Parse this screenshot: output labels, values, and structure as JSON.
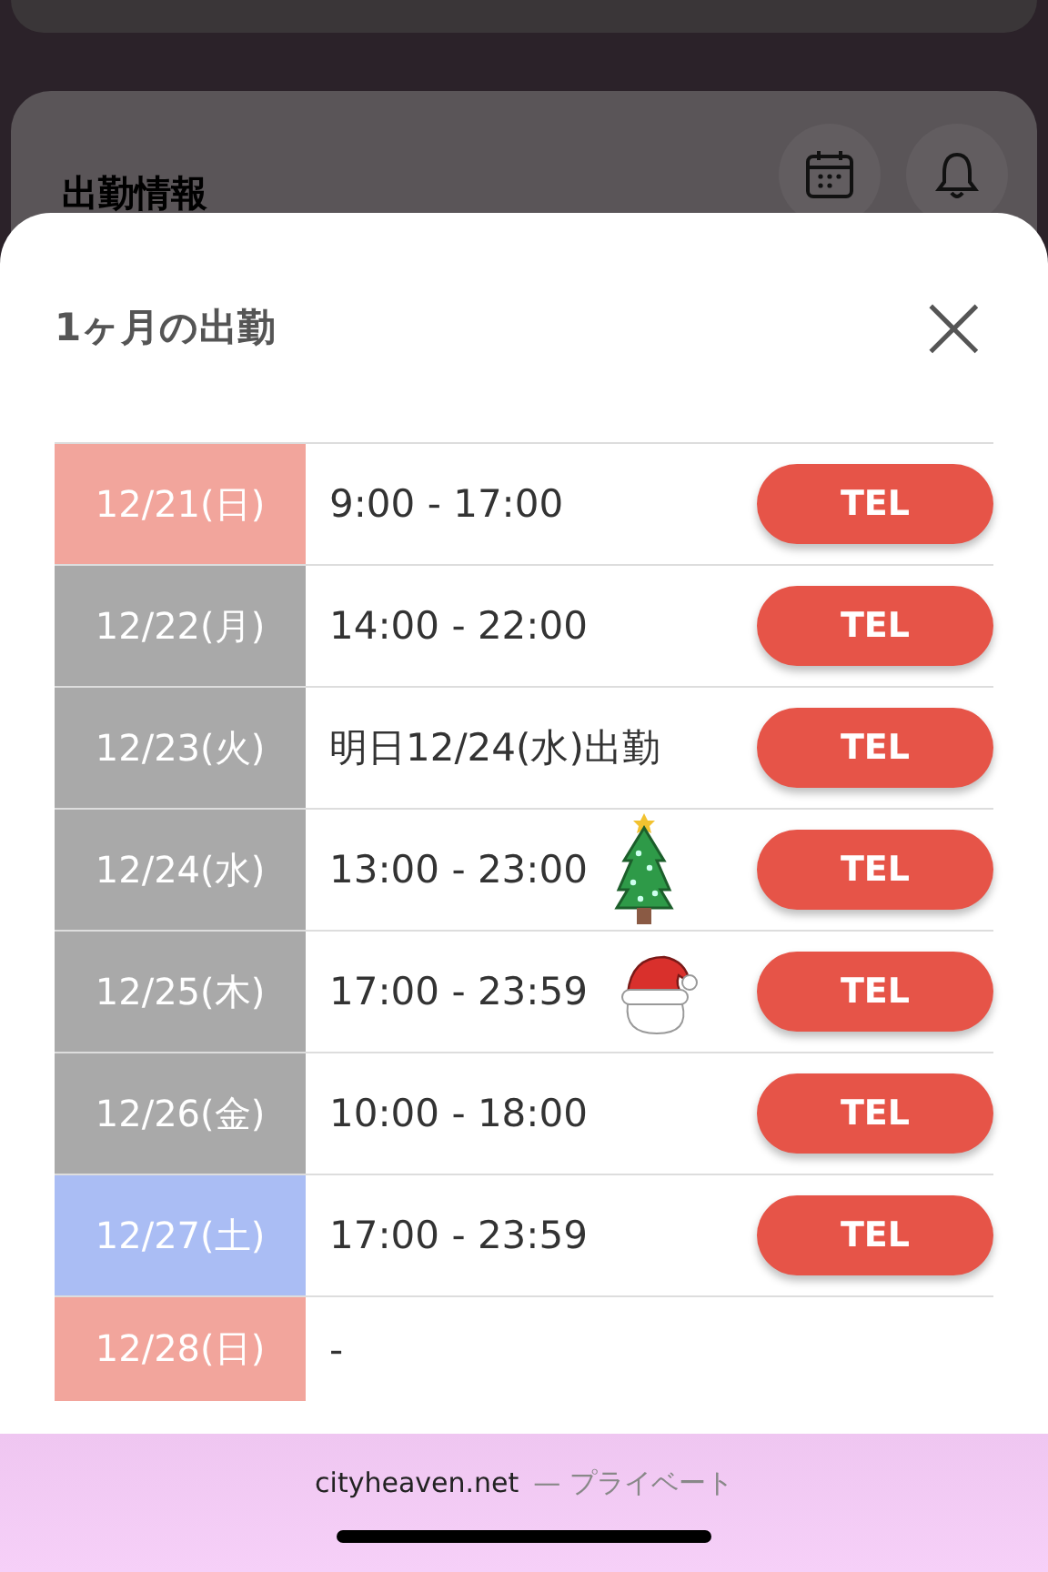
{
  "background": {
    "section_title": "出勤情報"
  },
  "modal": {
    "title": "1ヶ月の出勤",
    "close": "×"
  },
  "schedule": [
    {
      "kind": "plain",
      "date": "12/21(日)",
      "color": "#f2a59c",
      "hours": "9:00 - 17:00",
      "button": "TEL"
    },
    {
      "kind": "plain",
      "date": "12/22(月)",
      "color": "#a9a9a9",
      "hours": "14:00 - 22:00",
      "button": "TEL"
    },
    {
      "kind": "plain",
      "date": "12/23(火)",
      "color": "#a9a9a9",
      "hours": "明日12/24(水)出勤",
      "button": "TEL"
    },
    {
      "kind": "tree",
      "date": "12/24(水)",
      "color": "#a9a9a9",
      "hours": "13:00 - 23:00",
      "button": "TEL"
    },
    {
      "kind": "hat",
      "date": "12/25(木)",
      "color": "#a9a9a9",
      "hours": "17:00 - 23:59",
      "button": "TEL"
    },
    {
      "kind": "plain",
      "date": "12/26(金)",
      "color": "#a9a9a9",
      "hours": "10:00 - 18:00",
      "button": "TEL"
    },
    {
      "kind": "plain",
      "date": "12/27(土)",
      "color": "#aabdf4",
      "hours": "17:00 - 23:59",
      "button": "TEL"
    },
    {
      "kind": "plain",
      "date": "12/28(日)",
      "color": "#f2a59c",
      "hours": "-"
    }
  ],
  "browser_bar": {
    "domain": "cityheaven.net",
    "mode": "— プライベート"
  }
}
